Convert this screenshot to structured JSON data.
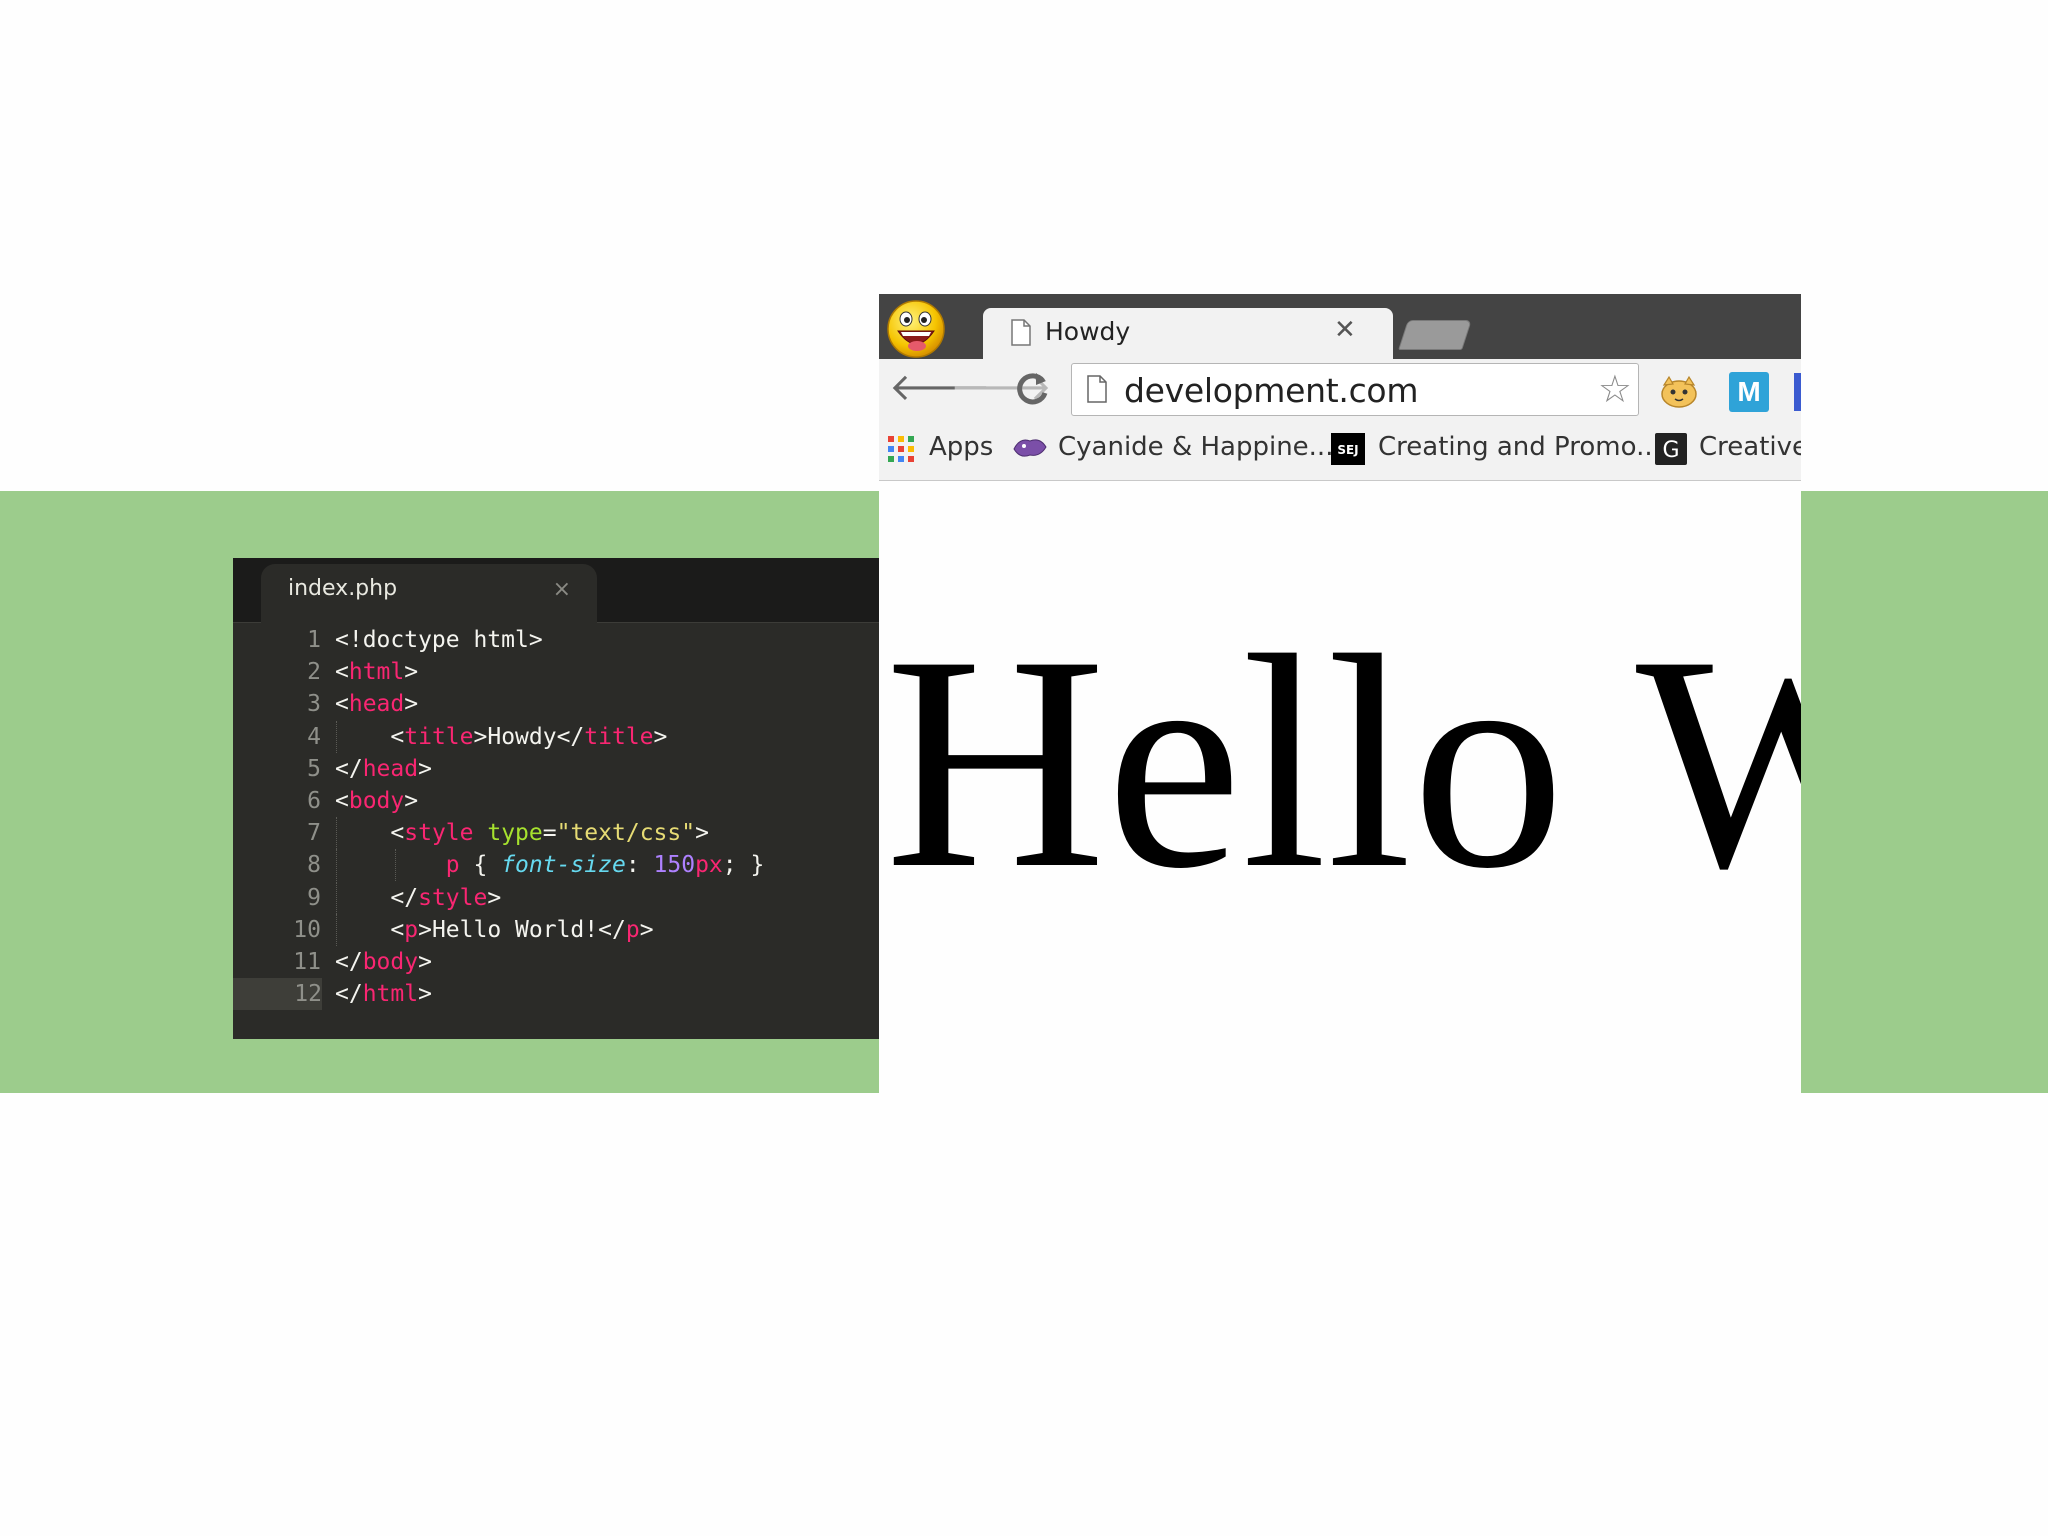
{
  "editor": {
    "tab_label": "index.php",
    "tab_close": "×",
    "lines": [
      {
        "n": "1",
        "html": "&lt;!doctype html&gt;"
      },
      {
        "n": "2",
        "html": "&lt;<span class=\"tag\">html</span>&gt;"
      },
      {
        "n": "3",
        "html": "&lt;<span class=\"tag\">head</span>&gt;"
      },
      {
        "n": "4",
        "html": "    &lt;<span class=\"tag\">title</span>&gt;Howdy&lt;/<span class=\"tag\">title</span>&gt;"
      },
      {
        "n": "5",
        "html": "&lt;/<span class=\"tag\">head</span>&gt;"
      },
      {
        "n": "6",
        "html": "&lt;<span class=\"tag\">body</span>&gt;"
      },
      {
        "n": "7",
        "html": "    &lt;<span class=\"tag\">style</span> <span class=\"attr\">type</span>=<span class=\"str\">\"text/css\"</span>&gt;"
      },
      {
        "n": "8",
        "html": "        <span class=\"tag\">p</span> { <span class=\"prop\">font-size</span>: <span class=\"num\">150</span><span class=\"tag\">px</span>; }"
      },
      {
        "n": "9",
        "html": "    &lt;/<span class=\"tag\">style</span>&gt;"
      },
      {
        "n": "10",
        "html": "    &lt;<span class=\"tag\">p</span>&gt;Hello World!&lt;/<span class=\"tag\">p</span>&gt;"
      },
      {
        "n": "11",
        "html": "&lt;/<span class=\"tag\">body</span>&gt;"
      },
      {
        "n": "12",
        "html": "&lt;/<span class=\"tag\">html</span>&gt;"
      }
    ],
    "current_line": "12",
    "colors": {
      "tag": "#f92672",
      "attr": "#a6e22e",
      "string": "#e6db74",
      "property": "#66d9ef",
      "number": "#ae81ff",
      "background": "#2b2b28"
    }
  },
  "browser": {
    "tab_title": "Howdy",
    "tab_close": "✕",
    "url": "development.com",
    "icons": {
      "back": "arrow-left-icon",
      "forward": "arrow-right-icon",
      "reload": "reload-icon",
      "star": "star-icon"
    },
    "bookmarks": [
      {
        "label": "Apps",
        "icon": "apps-grid-icon"
      },
      {
        "label": "Cyanide & Happine...",
        "icon": "cyanide-bird-icon"
      },
      {
        "label": "Creating and Promo...",
        "icon": "sej-logo-icon"
      },
      {
        "label": "Creative",
        "icon": "g-logo-icon"
      }
    ],
    "page_text": "Hello World!"
  },
  "background_color": "#9ccc8c"
}
